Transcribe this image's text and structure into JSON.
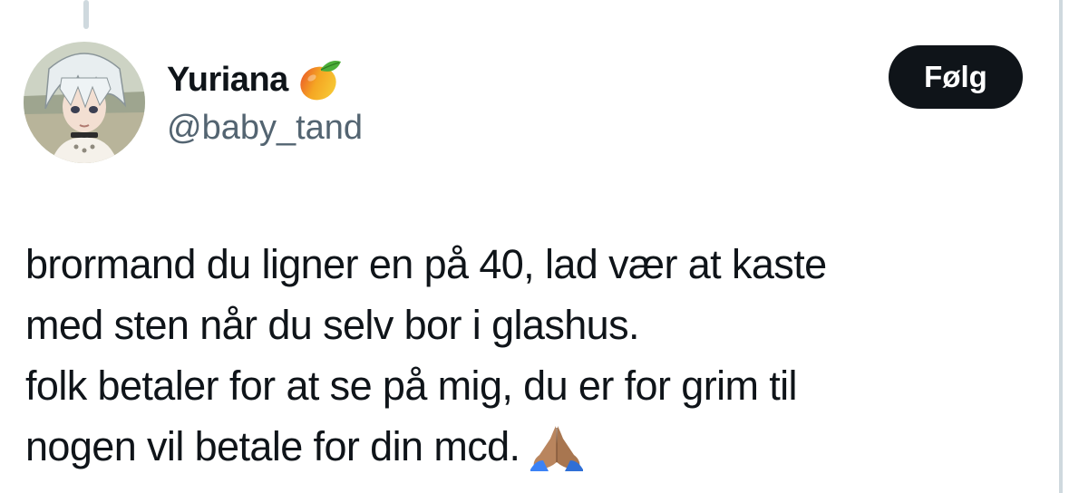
{
  "author": {
    "display_name": "Yuriana",
    "handle": "@baby_tand",
    "name_emoji": "mango-emoji",
    "avatar": "anime-avatar"
  },
  "actions": {
    "follow_label": "Følg"
  },
  "tweet": {
    "lines": [
      "brormand du ligner en på 40, lad vær at kaste",
      "med sten når du selv bor i glashus.",
      "folk betaler for at se på mig, du er for grim til",
      "nogen vil betale for din mcd."
    ],
    "end_emoji": "folded-hands-emoji"
  },
  "colors": {
    "text": "#0f1419",
    "secondary_text": "#536471",
    "button_bg": "#0f1419",
    "button_text": "#ffffff",
    "border": "#cfd9de"
  }
}
